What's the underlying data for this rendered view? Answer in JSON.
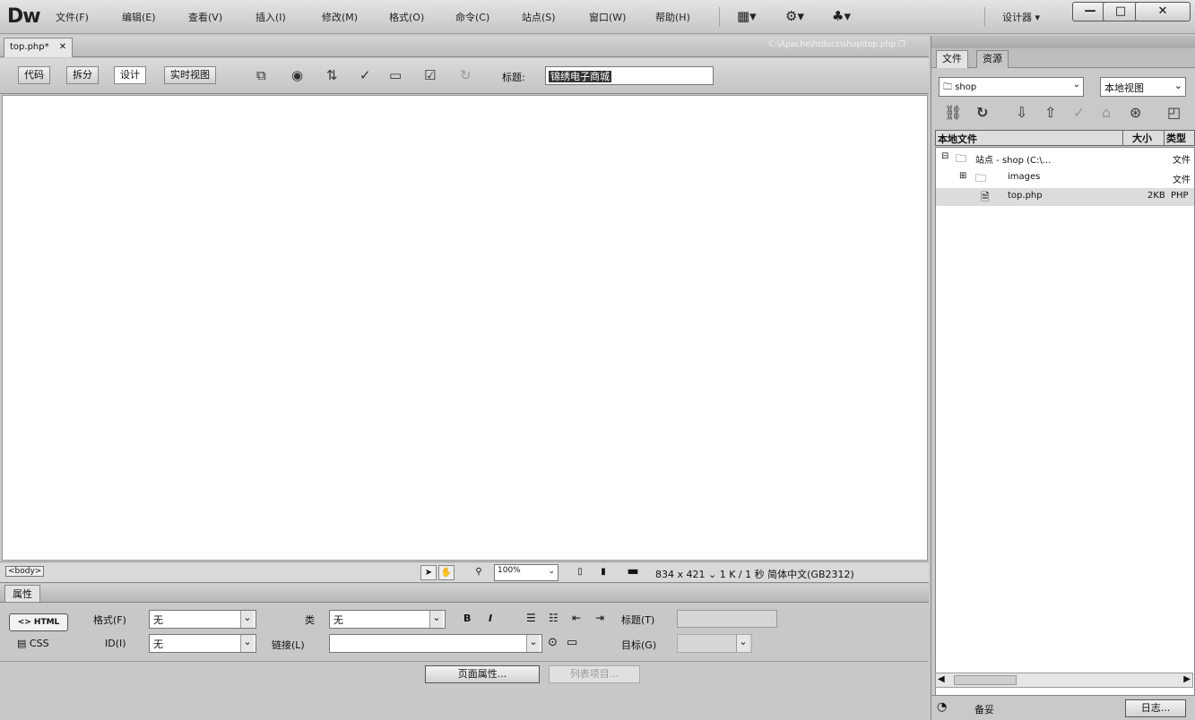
{
  "app": {
    "logo": "Dw",
    "workspace": "设计器"
  },
  "menus": [
    "文件(F)",
    "编辑(E)",
    "查看(V)",
    "插入(I)",
    "修改(M)",
    "格式(O)",
    "命令(C)",
    "站点(S)",
    "窗口(W)",
    "帮助(H)"
  ],
  "window_buttons": {
    "minimize": "—",
    "maximize": "□",
    "close": "✕"
  },
  "doc": {
    "tab_label": "top.php*",
    "tab_close": "✕",
    "path": "C:\\Apache\\htdocs\\shop\\top.php",
    "view_buttons": [
      "代码",
      "拆分",
      "设计",
      "实时视图"
    ],
    "active_view": "设计",
    "title_label": "标题:",
    "title_value": "锦绣电子商城"
  },
  "status": {
    "tag": "<body>",
    "zoom": "100%",
    "size": "834 x 421",
    "download": "1 K / 1 秒",
    "encoding": "简体中文(GB2312)"
  },
  "properties": {
    "panel_title": "属性",
    "html_btn": "<> HTML",
    "css_btn": "CSS",
    "format_label": "格式(F)",
    "format_value": "无",
    "id_label": "ID(I)",
    "id_value": "无",
    "class_label": "类",
    "class_value": "无",
    "link_label": "链接(L)",
    "link_value": "",
    "bold": "B",
    "italic": "I",
    "title_label": "标题(T)",
    "target_label": "目标(G)",
    "page_props_btn": "页面属性...",
    "list_item_btn": "列表项目..."
  },
  "files_panel": {
    "tabs": [
      "文件",
      "资源"
    ],
    "site": "shop",
    "view": "本地视图",
    "columns": [
      "本地文件",
      "大小",
      "类型"
    ],
    "rows": [
      {
        "name": "站点 - shop (C:\\...",
        "size": "",
        "type": "文件"
      },
      {
        "name": "images",
        "size": "",
        "type": "文件"
      },
      {
        "name": "top.php",
        "size": "2KB",
        "type": "PHP"
      }
    ],
    "bottom_label": "备妥",
    "log_btn": "日志..."
  }
}
